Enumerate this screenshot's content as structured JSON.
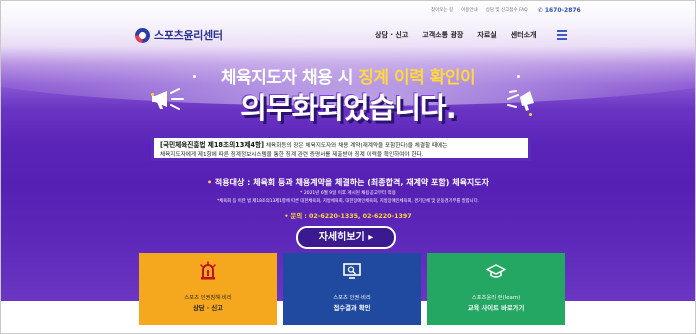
{
  "header": {
    "logo_text": "스포츠윤리센터",
    "util": [
      "찾아오는 길",
      "이용안내",
      "상담 및 신고접수 FAQ"
    ],
    "phone": "1670-2876",
    "nav": [
      "상담 · 신고",
      "고객소통 광장",
      "자료실",
      "센터소개"
    ]
  },
  "hero": {
    "title_pre": "체육지도자 채용 시 ",
    "title_hl": "징계 이력 확인이",
    "title_big": "의무화되었습니다.",
    "notice_bold": "[국민체육진흥법 제18조의13제4항]",
    "notice_line1": " 체육회등의 장은 체육지도자와 채용 계약(재계약을 포함한다)을 체결할 때에는",
    "notice_line2": "체육지도자에게 제1항에 따른 징계정보시스템을 통한 징계 관련 증명서를 제출받아 징계 이력을 확인하여야 한다.",
    "target_bullet": "•",
    "target_text": " 적용대상 : 체육회 등과 채용계약을 체결하는 (최종합격, 재계약 포함) 체육지도자",
    "sub1": "* 2021년 6월 9일 이후 게시된 채용공고부터 적용",
    "sub2": "*체육회 등 이란 법 제18조의13제1항에 따른 대한체육회, 지방체육회, 대한장애인체육회, 지방장애인체육회, 경기단체 및 운동경기부를 말합니다.",
    "contact": "• 문의 : 02-6220-1335, 02-6220-1397",
    "detail_button": "자세히보기 ▸"
  },
  "cards": [
    {
      "line1": "스포츠 인권침해·비리",
      "line2": "상담 · 신고",
      "icon": "siren-icon"
    },
    {
      "line1": "스포츠 인권·비리",
      "line2": "접수결과 확인",
      "icon": "monitor-search-icon"
    },
    {
      "line1": "스포츠윤리 런(learn)",
      "line2": "교육 사이트 바로가기",
      "icon": "graduation-cap-icon"
    }
  ],
  "colors": {
    "accent_yellow": "#ffd83a",
    "card1": "#f5a81d",
    "card2": "#1f4aa0",
    "card3": "#24a763",
    "purple": "#5620b5"
  }
}
